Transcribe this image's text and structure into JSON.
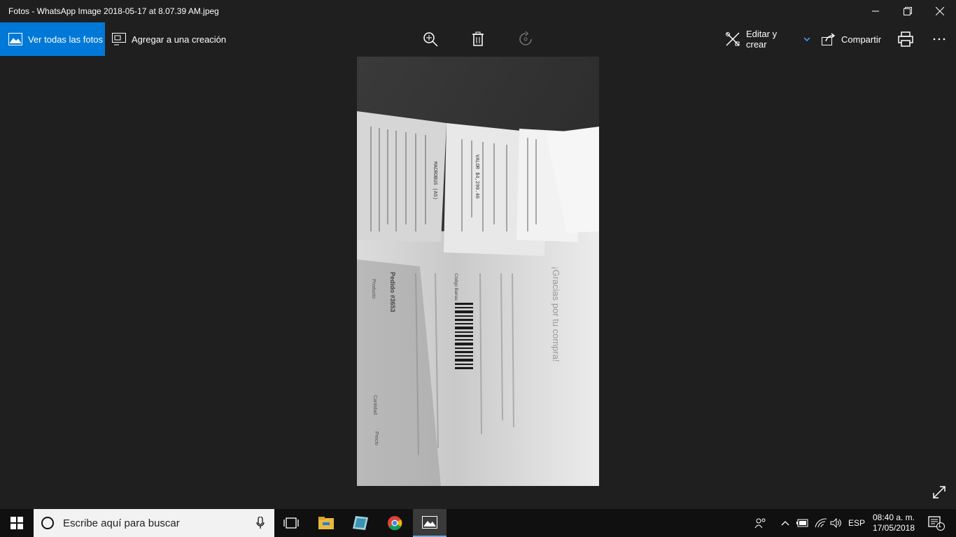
{
  "window": {
    "title": "Fotos - WhatsApp Image 2018-05-17 at 8.07.39 AM.jpeg"
  },
  "toolbar": {
    "view_all_label": "Ver todas las fotos",
    "add_to_creation_label": "Agregar a una creación",
    "edit_create_label": "Editar y crear",
    "share_label": "Compartir"
  },
  "photo": {
    "receipt_lines": [
      "MACROBUS (AS)",
      "VALOR $4,290.40",
      "Pedido #3653"
    ],
    "receipt_heading": "¡Gracias por tu compra!",
    "barcode_label": "Código Barras:",
    "product_header": "Producto",
    "quantity_header": "Cantidad",
    "price_header": "Precio"
  },
  "taskbar": {
    "search_placeholder": "Escribe aquí para buscar",
    "language": "ESP",
    "time": "08:40 a. m.",
    "date": "17/05/2018",
    "notification_count": "1"
  },
  "colors": {
    "accent": "#0078d7",
    "background": "#1f1f1f",
    "taskbar": "#101010"
  }
}
